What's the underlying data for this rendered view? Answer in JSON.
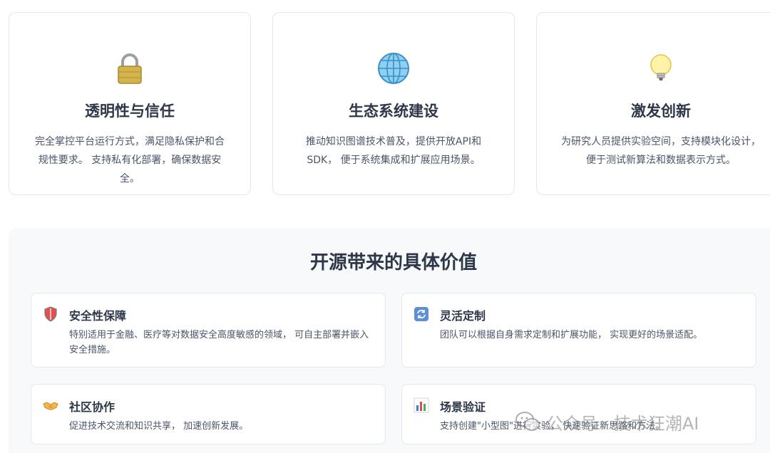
{
  "top_cards": [
    {
      "icon": "lock-icon",
      "title": "透明性与信任",
      "desc": "完全掌控平台运行方式，满足隐私保护和合规性要求。 支持私有化部署，确保数据安全。"
    },
    {
      "icon": "globe-icon",
      "title": "生态系统建设",
      "desc": "推动知识图谱技术普及，提供开放API和SDK， 便于系统集成和扩展应用场景。"
    },
    {
      "icon": "lightbulb-icon",
      "title": "激发创新",
      "desc": "为研究人员提供实验空间，支持模块化设计， 便于测试新算法和数据表示方式。"
    }
  ],
  "value_section": {
    "title": "开源带来的具体价值",
    "items": [
      {
        "icon": "shield-icon",
        "title": "安全性保障",
        "desc": "特别适用于金融、医疗等对数据安全高度敏感的领域， 可自主部署并嵌入安全措施。"
      },
      {
        "icon": "refresh-icon",
        "title": "灵活定制",
        "desc": "团队可以根据自身需求定制和扩展功能， 实现更好的场景适配。"
      },
      {
        "icon": "handshake-icon",
        "title": "社区协作",
        "desc": "促进技术交流和知识共享， 加速创新发展。"
      },
      {
        "icon": "bar-chart-icon",
        "title": "场景验证",
        "desc": "支持创建\"小型图\"进行实验， 快速验证新思路和方法。"
      }
    ]
  },
  "watermark": {
    "text": "公众号 · 技术狂潮AI",
    "icon": "wechat-icon"
  }
}
